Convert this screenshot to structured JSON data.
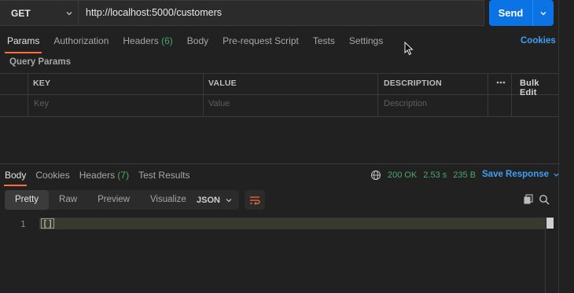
{
  "request": {
    "method": "GET",
    "url": "http://localhost:5000/customers",
    "send_label": "Send"
  },
  "request_tabs": [
    {
      "label": "Params",
      "count": ""
    },
    {
      "label": "Authorization",
      "count": ""
    },
    {
      "label": "Headers",
      "count": "(6)"
    },
    {
      "label": "Body",
      "count": ""
    },
    {
      "label": "Pre-request Script",
      "count": ""
    },
    {
      "label": "Tests",
      "count": ""
    },
    {
      "label": "Settings",
      "count": ""
    }
  ],
  "cookies_label": "Cookies",
  "query_params": {
    "title": "Query Params",
    "headers": {
      "key": "KEY",
      "value": "VALUE",
      "description": "DESCRIPTION",
      "bulk_edit": "Bulk Edit"
    },
    "placeholders": {
      "key": "Key",
      "value": "Value",
      "description": "Description"
    }
  },
  "response_tabs": [
    {
      "label": "Body",
      "count": ""
    },
    {
      "label": "Cookies",
      "count": ""
    },
    {
      "label": "Headers",
      "count": "(7)"
    },
    {
      "label": "Test Results",
      "count": ""
    }
  ],
  "response_status": {
    "status": "200 OK",
    "time": "2.53 s",
    "size": "235 B"
  },
  "save_response_label": "Save Response",
  "view_modes": [
    "Pretty",
    "Raw",
    "Preview",
    "Visualize"
  ],
  "format": "JSON",
  "code": {
    "line_number": "1",
    "content": "[]"
  },
  "colors": {
    "accent": "#ff6c37",
    "primary": "#0b73e3",
    "link": "#3d9ff5",
    "success": "#4aa86b"
  }
}
